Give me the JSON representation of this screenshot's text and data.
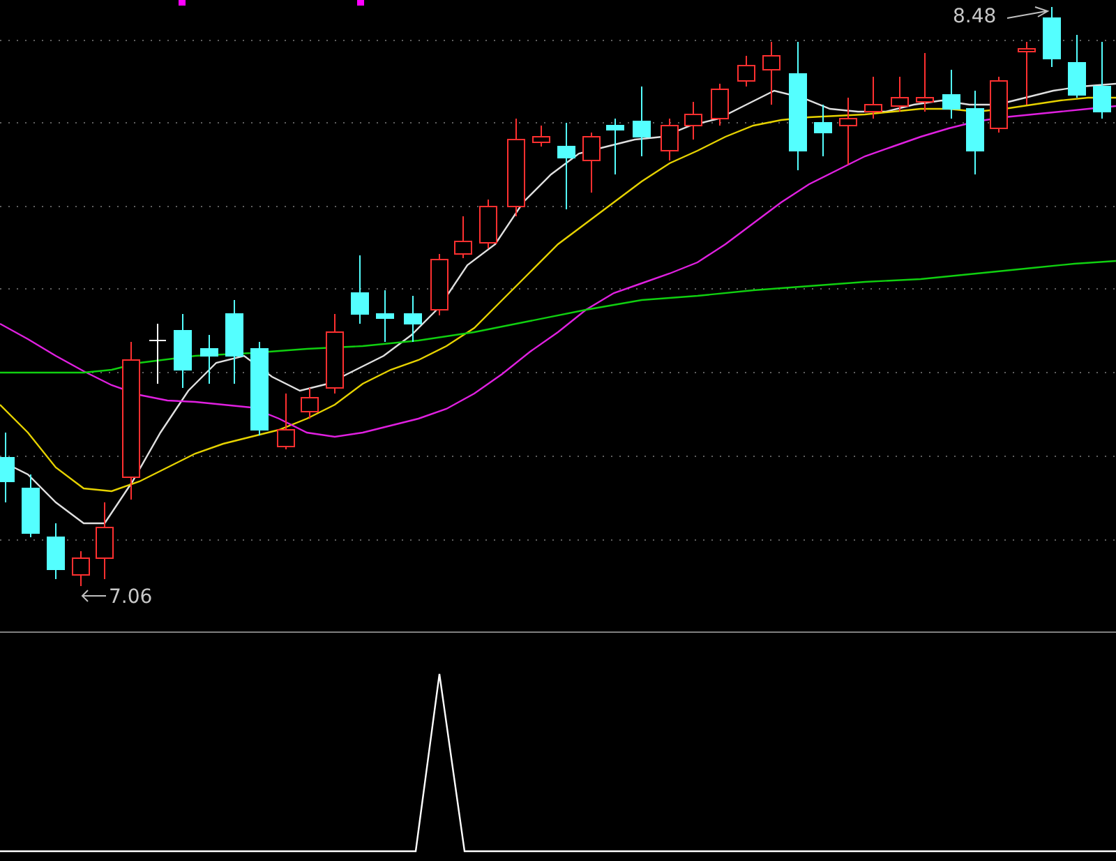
{
  "price_labels": [
    {
      "kind": "high",
      "text": "8.48"
    },
    {
      "kind": "low",
      "text": "7.06"
    }
  ]
}
